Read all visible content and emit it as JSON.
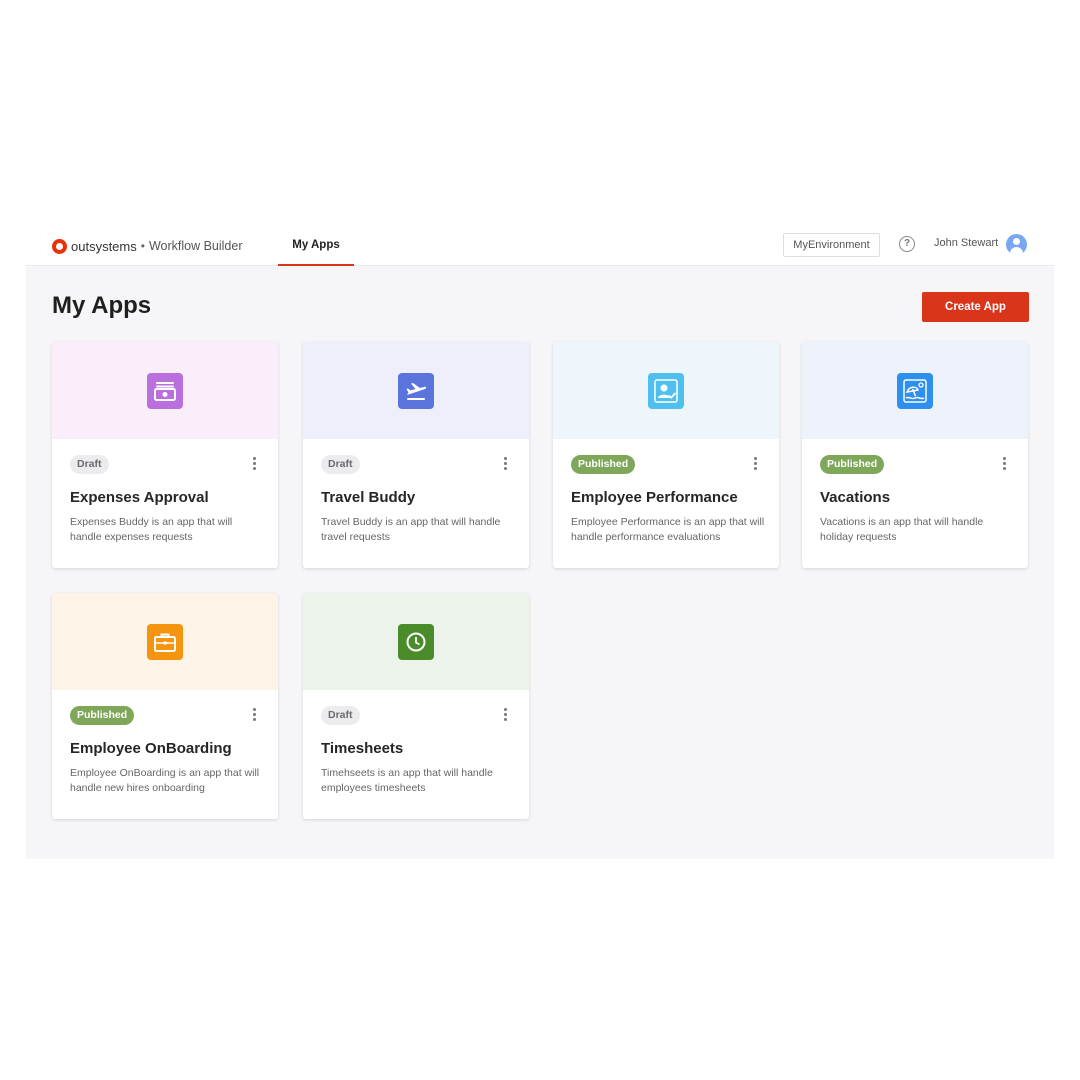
{
  "header": {
    "brand": "outsystems",
    "separator": "•",
    "product": "Workflow Builder",
    "nav_tab": "My Apps",
    "environment": "MyEnvironment",
    "help_symbol": "?",
    "user_name": "John Stewart"
  },
  "page": {
    "title": "My Apps",
    "create_button": "Create App"
  },
  "colors": {
    "accent": "#d8351b",
    "published_badge": "#7fa75a",
    "draft_badge": "#ececef"
  },
  "apps": [
    {
      "status": "Draft",
      "title": "Expenses Approval",
      "description": "Expenses Buddy is an app that will handle expenses requests",
      "icon": "money-icon",
      "icon_color": "#b96fdc",
      "banner_color": "#fbeefb"
    },
    {
      "status": "Draft",
      "title": "Travel Buddy",
      "description": "Travel Buddy is an app that will handle travel requests",
      "icon": "airplane-icon",
      "icon_color": "#5b74dd",
      "banner_color": "#eeeffb"
    },
    {
      "status": "Published",
      "title": "Employee Performance",
      "description": "Employee Performance is an app that will handle performance evaluations",
      "icon": "user-check-icon",
      "icon_color": "#4fbfee",
      "banner_color": "#eef5fb"
    },
    {
      "status": "Published",
      "title": "Vacations",
      "description": "Vacations is an app that will handle holiday requests",
      "icon": "beach-icon",
      "icon_color": "#2d8ff0",
      "banner_color": "#eef2fb"
    },
    {
      "status": "Published",
      "title": "Employee OnBoarding",
      "description": "Employee OnBoarding is an app that will handle new hires onboarding",
      "icon": "briefcase-icon",
      "icon_color": "#f5940f",
      "banner_color": "#fdf3e6"
    },
    {
      "status": "Draft",
      "title": "Timesheets",
      "description": "Timehseets is an app that will handle employees timesheets",
      "icon": "clock-icon",
      "icon_color": "#4a8c2a",
      "banner_color": "#ecf3ea"
    }
  ]
}
